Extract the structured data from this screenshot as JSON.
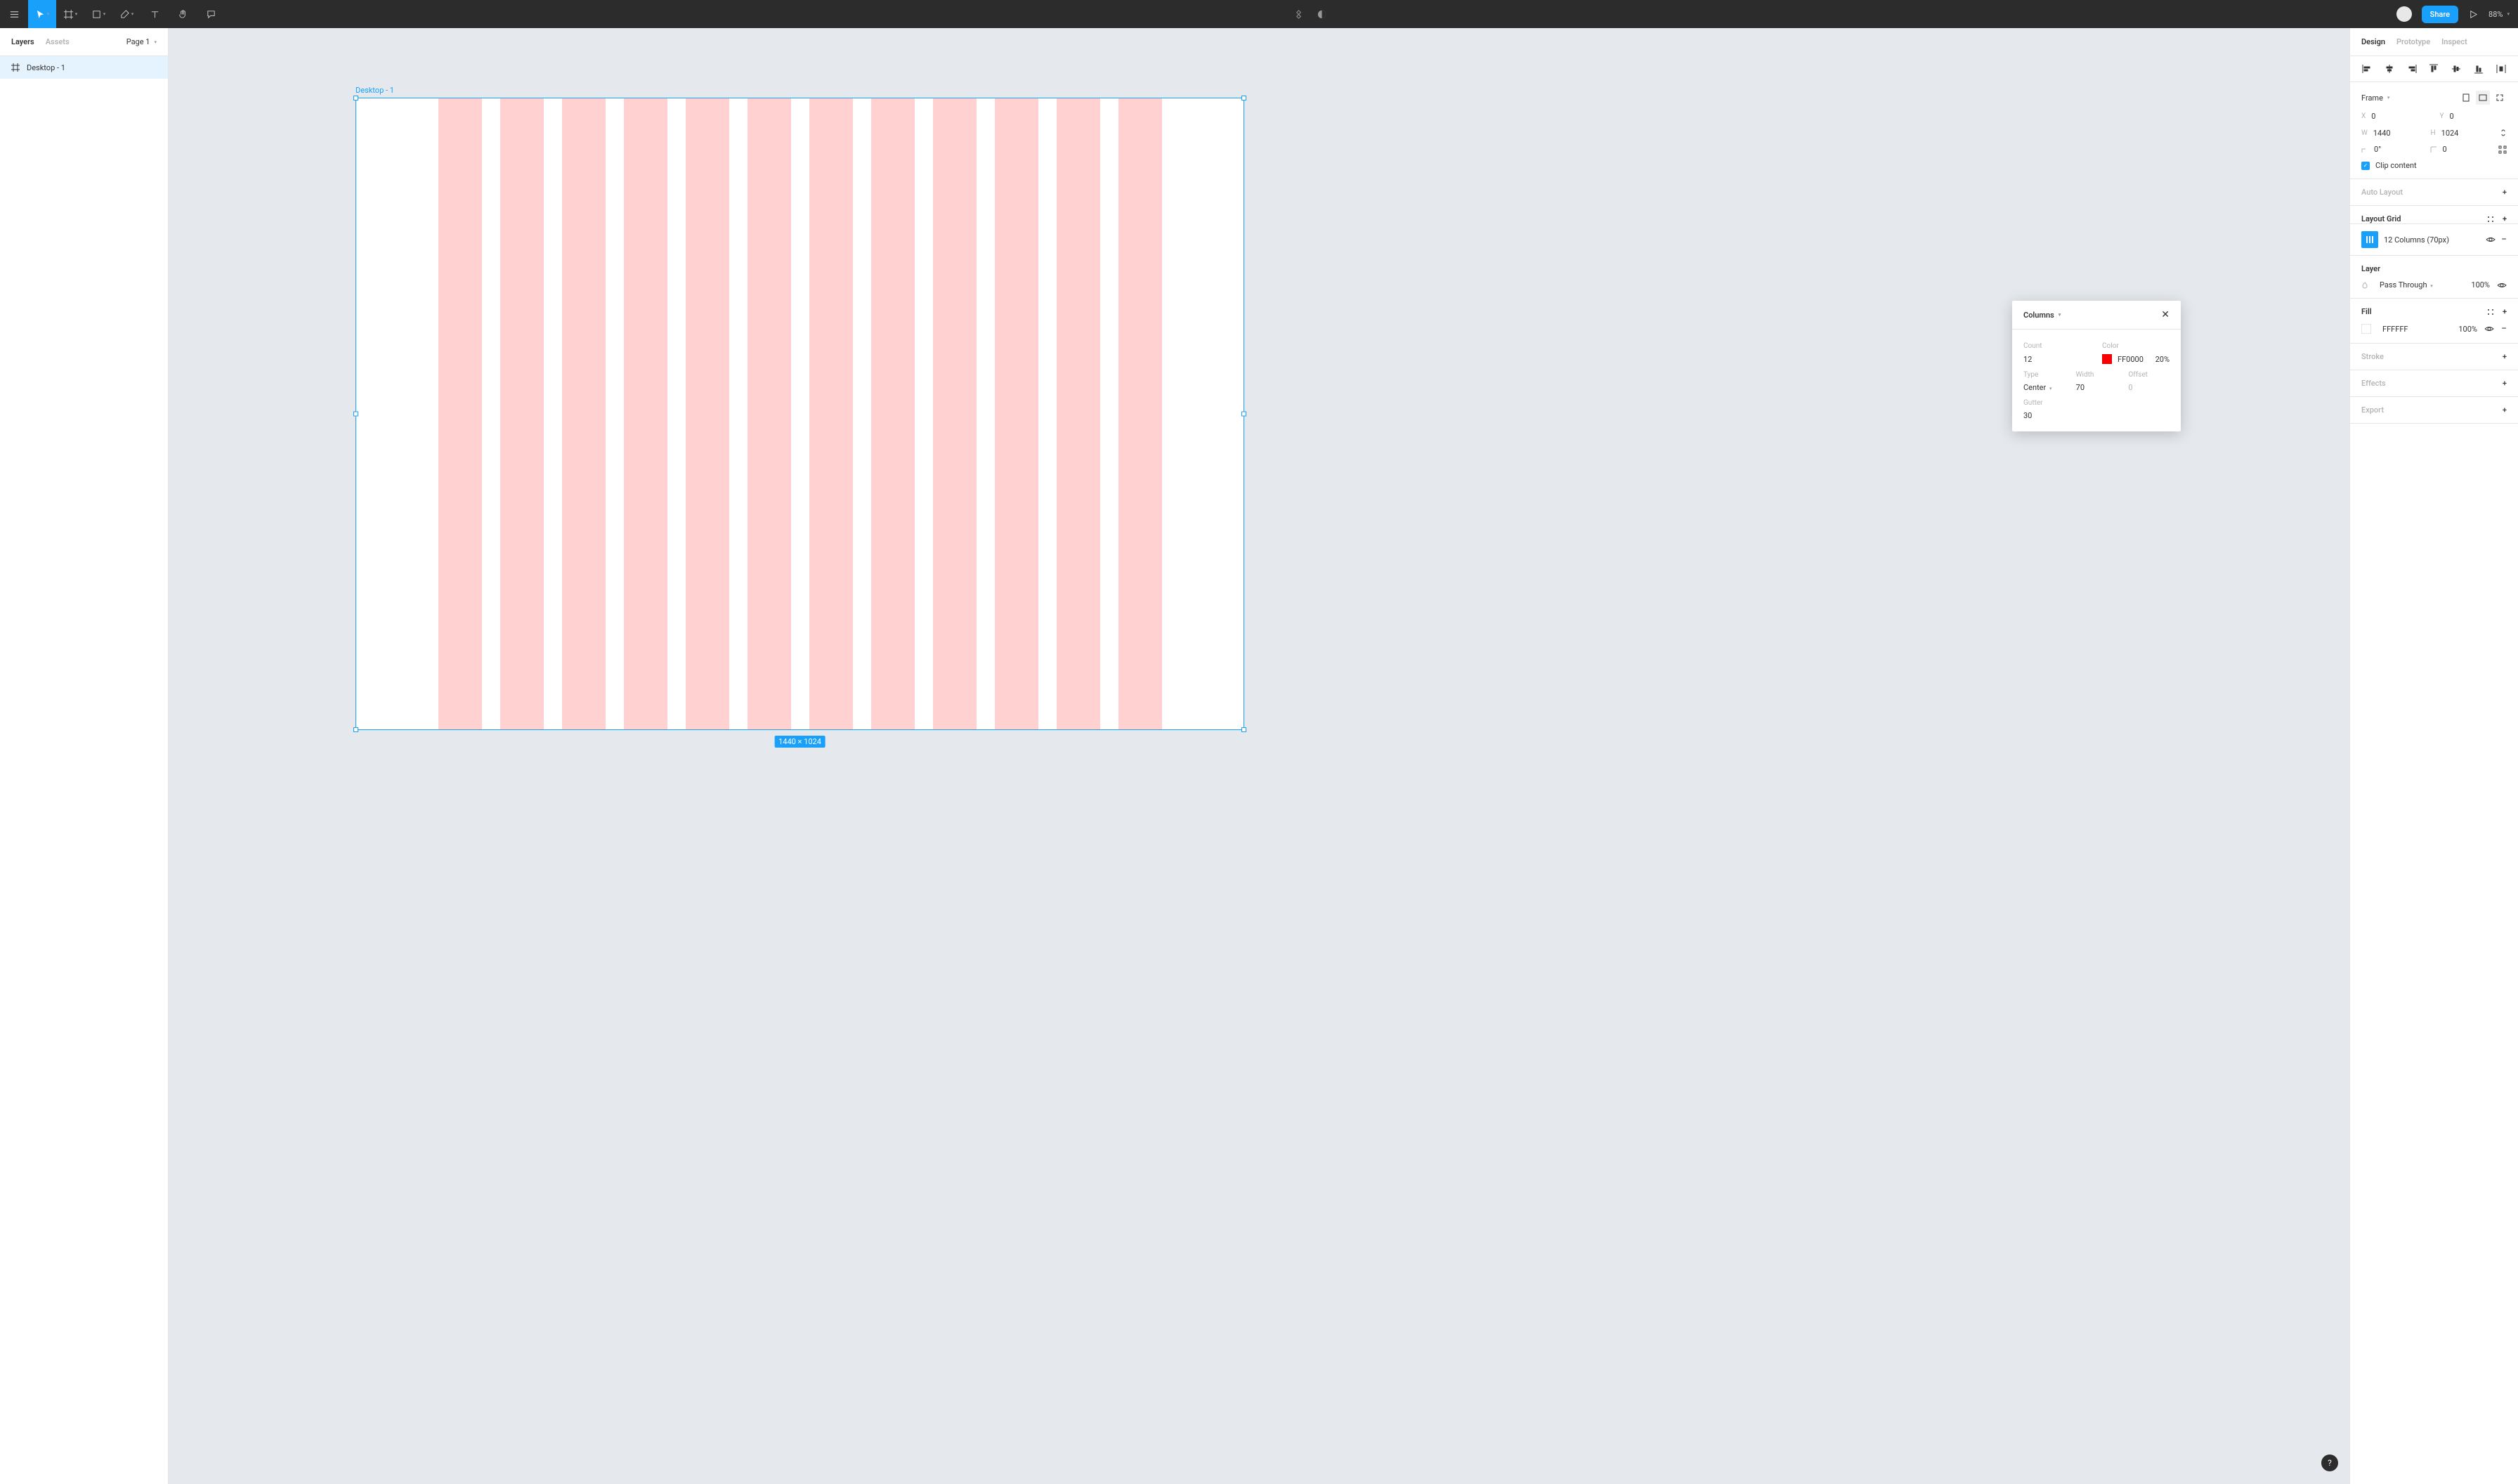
{
  "toolbar": {
    "share_label": "Share",
    "zoom": "88%"
  },
  "leftPanel": {
    "tabs": {
      "layers": "Layers",
      "assets": "Assets"
    },
    "page": "Page 1",
    "layer_name": "Desktop - 1"
  },
  "canvas": {
    "frame_label": "Desktop - 1",
    "size_badge": "1440 × 1024"
  },
  "rightPanel": {
    "tabs": {
      "design": "Design",
      "prototype": "Prototype",
      "inspect": "Inspect"
    },
    "frame": {
      "label": "Frame",
      "x_label": "X",
      "x_value": "0",
      "y_label": "Y",
      "y_value": "0",
      "w_label": "W",
      "w_value": "1440",
      "h_label": "H",
      "h_value": "1024",
      "rotation": "0°",
      "radius": "0",
      "clip_label": "Clip content"
    },
    "autolayout": {
      "title": "Auto Layout"
    },
    "layoutgrid": {
      "title": "Layout Grid",
      "item_label": "12 Columns (70px)"
    },
    "layer": {
      "title": "Layer",
      "blend": "Pass Through",
      "opacity": "100%"
    },
    "fill": {
      "title": "Fill",
      "hex": "FFFFFF",
      "opacity": "100%"
    },
    "stroke": {
      "title": "Stroke"
    },
    "effects": {
      "title": "Effects"
    },
    "export": {
      "title": "Export"
    }
  },
  "popup": {
    "title": "Columns",
    "count_label": "Count",
    "color_label": "Color",
    "count_value": "12",
    "color_hex": "FF0000",
    "color_opacity": "20%",
    "type_label": "Type",
    "width_label": "Width",
    "offset_label": "Offset",
    "type_value": "Center",
    "width_value": "70",
    "offset_value": "0",
    "gutter_label": "Gutter",
    "gutter_value": "30"
  },
  "help": "?"
}
